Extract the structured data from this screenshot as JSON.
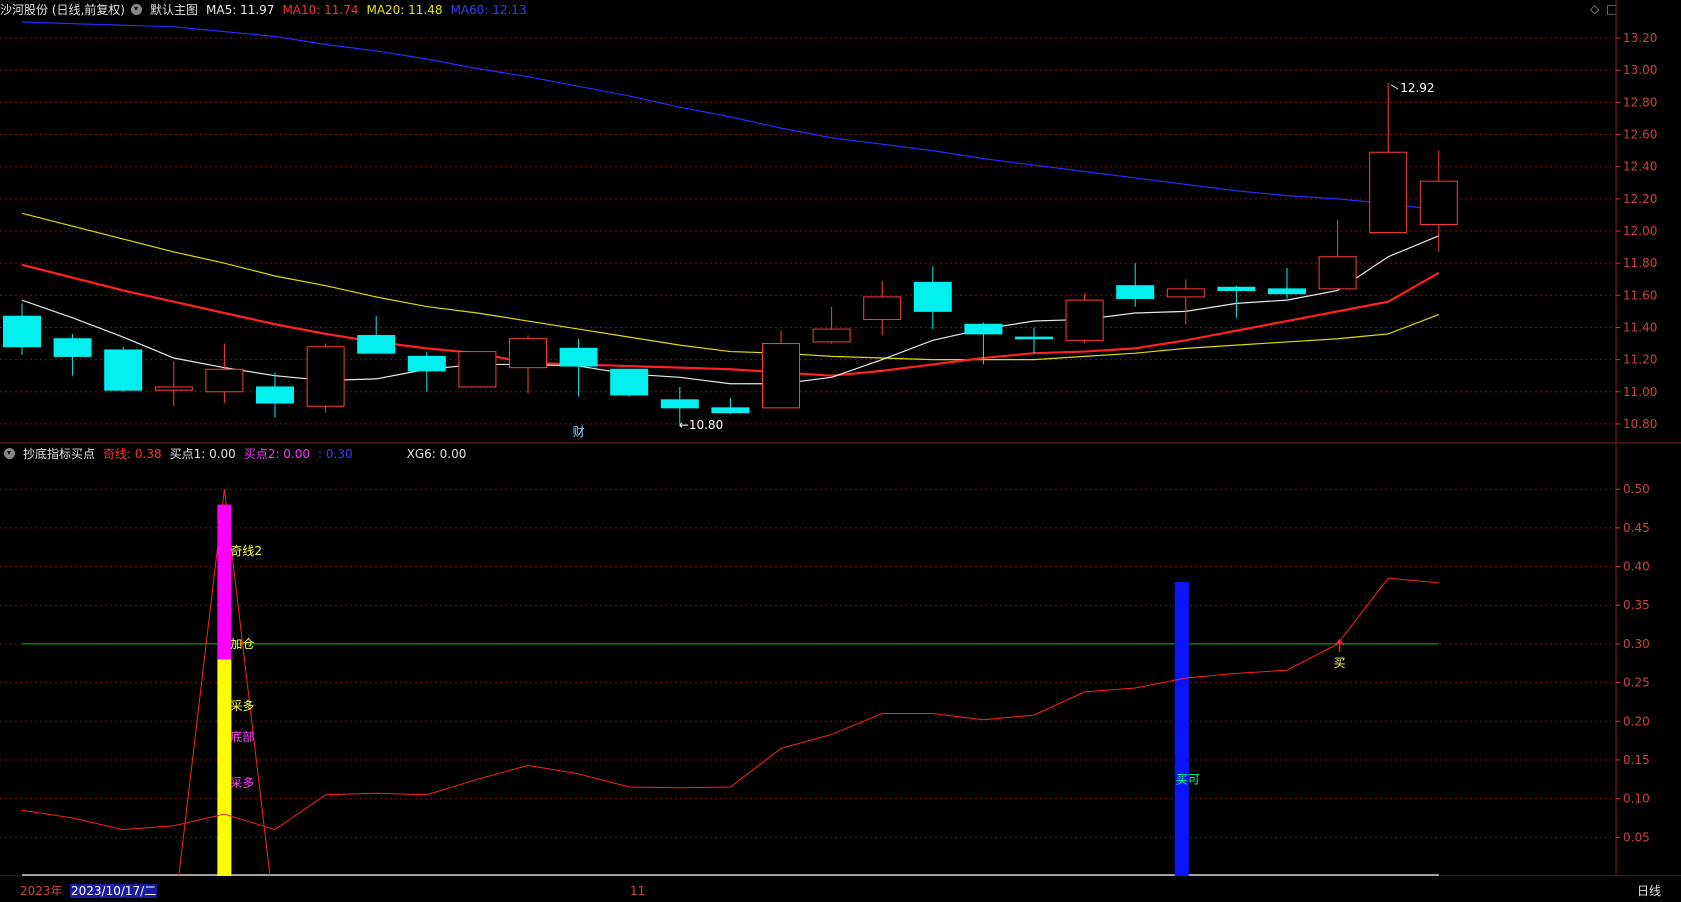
{
  "main_header": {
    "stock": "沙河股份 (日线,前复权)",
    "theme": "默认主图",
    "ma5": "MA5: 11.97",
    "ma10": "MA10: 11.74",
    "ma20": "MA20: 11.48",
    "ma60": "MA60: 12.13"
  },
  "indicator_header": {
    "name": "抄底指标买点",
    "qx": "奇线: 0.38",
    "buy1": "买点1: 0.00",
    "buy2": "买点2: 0.00",
    "blank": ": 0.30",
    "xg6": "XG6: 0.00"
  },
  "corner_controls": {
    "diamond": "◇",
    "square": "□"
  },
  "colors": {
    "bg": "#000000",
    "up": "#ff3c3c",
    "down": "#00f0f0",
    "ma5": "#e8e8e8",
    "ma10": "#ff2020",
    "ma20": "#dcdc00",
    "ma60": "#2a2aff",
    "grid": "#7a1010",
    "axis": "#d04040"
  },
  "price_axis": [
    "13.20",
    "13.00",
    "12.80",
    "12.60",
    "12.40",
    "12.20",
    "12.00",
    "11.80",
    "11.60",
    "11.40",
    "11.20",
    "11.00",
    "10.80"
  ],
  "indicator_axis": [
    "0.50",
    "0.45",
    "0.40",
    "0.35",
    "0.30",
    "0.25",
    "0.20",
    "0.15",
    "0.10",
    "0.05"
  ],
  "annotations": {
    "high": "12.92",
    "low": "←10.80",
    "cai": "财",
    "qx2": "奇线2",
    "jiacang": "加仓",
    "caiduo1": "采多",
    "dibu": "底部",
    "caiduo2": "采多",
    "maike": "买可",
    "mai": "买"
  },
  "time_bar": {
    "year": "2023年",
    "date": "2023/10/17/二",
    "month": "11",
    "period": "日线"
  },
  "chart_data": {
    "type": "candlestick",
    "candles": [
      {
        "o": 11.47,
        "h": 11.55,
        "l": 11.23,
        "c": 11.28
      },
      {
        "o": 11.33,
        "h": 11.36,
        "l": 11.1,
        "c": 11.22
      },
      {
        "o": 11.26,
        "h": 11.28,
        "l": 11.0,
        "c": 11.01
      },
      {
        "o": 11.01,
        "h": 11.19,
        "l": 10.91,
        "c": 11.03
      },
      {
        "o": 11.0,
        "h": 11.3,
        "l": 10.93,
        "c": 11.14
      },
      {
        "o": 11.03,
        "h": 11.12,
        "l": 10.84,
        "c": 10.93
      },
      {
        "o": 10.91,
        "h": 11.3,
        "l": 10.87,
        "c": 11.28
      },
      {
        "o": 11.35,
        "h": 11.47,
        "l": 11.24,
        "c": 11.24
      },
      {
        "o": 11.22,
        "h": 11.25,
        "l": 11.0,
        "c": 11.13
      },
      {
        "o": 11.03,
        "h": 11.25,
        "l": 11.03,
        "c": 11.25
      },
      {
        "o": 11.15,
        "h": 11.35,
        "l": 10.99,
        "c": 11.33
      },
      {
        "o": 11.27,
        "h": 11.33,
        "l": 10.97,
        "c": 11.16
      },
      {
        "o": 11.14,
        "h": 11.14,
        "l": 10.97,
        "c": 10.98
      },
      {
        "o": 10.95,
        "h": 11.03,
        "l": 10.8,
        "c": 10.9
      },
      {
        "o": 10.9,
        "h": 10.96,
        "l": 10.86,
        "c": 10.87
      },
      {
        "o": 10.9,
        "h": 11.38,
        "l": 10.9,
        "c": 11.3
      },
      {
        "o": 11.31,
        "h": 11.53,
        "l": 11.3,
        "c": 11.39
      },
      {
        "o": 11.45,
        "h": 11.69,
        "l": 11.35,
        "c": 11.59
      },
      {
        "o": 11.68,
        "h": 11.78,
        "l": 11.39,
        "c": 11.5
      },
      {
        "o": 11.42,
        "h": 11.43,
        "l": 11.17,
        "c": 11.36
      },
      {
        "o": 11.34,
        "h": 11.4,
        "l": 11.24,
        "c": 11.33
      },
      {
        "o": 11.32,
        "h": 11.61,
        "l": 11.3,
        "c": 11.57
      },
      {
        "o": 11.66,
        "h": 11.8,
        "l": 11.53,
        "c": 11.58
      },
      {
        "o": 11.59,
        "h": 11.7,
        "l": 11.42,
        "c": 11.64
      },
      {
        "o": 11.65,
        "h": 11.66,
        "l": 11.46,
        "c": 11.63
      },
      {
        "o": 11.64,
        "h": 11.77,
        "l": 11.58,
        "c": 11.61
      },
      {
        "o": 11.64,
        "h": 12.07,
        "l": 11.64,
        "c": 11.84
      },
      {
        "o": 11.99,
        "h": 12.92,
        "l": 11.99,
        "c": 12.49
      },
      {
        "o": 12.04,
        "h": 12.5,
        "l": 11.87,
        "c": 12.31
      }
    ],
    "ma5": [
      11.57,
      11.46,
      11.34,
      11.21,
      11.15,
      11.1,
      11.07,
      11.08,
      11.14,
      11.17,
      11.17,
      11.16,
      11.11,
      11.09,
      11.05,
      11.05,
      11.09,
      11.2,
      11.32,
      11.39,
      11.44,
      11.45,
      11.49,
      11.5,
      11.55,
      11.57,
      11.63,
      11.84,
      11.97
    ],
    "ma10": [
      11.79,
      11.71,
      11.63,
      11.56,
      11.49,
      11.42,
      11.36,
      11.31,
      11.27,
      11.24,
      11.18,
      11.17,
      11.16,
      11.15,
      11.14,
      11.12,
      11.1,
      11.13,
      11.17,
      11.21,
      11.24,
      11.25,
      11.27,
      11.32,
      11.38,
      11.44,
      11.5,
      11.56,
      11.74
    ],
    "ma20": [
      12.11,
      12.03,
      11.95,
      11.87,
      11.8,
      11.72,
      11.66,
      11.59,
      11.53,
      11.49,
      11.44,
      11.39,
      11.34,
      11.29,
      11.25,
      11.24,
      11.22,
      11.21,
      11.2,
      11.2,
      11.2,
      11.22,
      11.24,
      11.27,
      11.29,
      11.31,
      11.33,
      11.36,
      11.48
    ],
    "ma60": [
      13.3,
      13.29,
      13.28,
      13.27,
      13.24,
      13.21,
      13.16,
      13.12,
      13.07,
      13.01,
      12.96,
      12.9,
      12.84,
      12.77,
      12.71,
      12.64,
      12.58,
      12.54,
      12.5,
      12.45,
      12.41,
      12.37,
      12.33,
      12.29,
      12.25,
      12.22,
      12.2,
      12.17,
      12.13
    ],
    "indicator": {
      "line": [
        0.085,
        0.075,
        0.06,
        0.065,
        0.08,
        0.06,
        0.105,
        0.107,
        0.105,
        0.125,
        0.143,
        0.132,
        0.115,
        0.114,
        0.115,
        0.165,
        0.183,
        0.21,
        0.21,
        0.202,
        0.208,
        0.238,
        0.243,
        0.256,
        0.262,
        0.266,
        0.3,
        0.385,
        0.379
      ],
      "reference_line": 0.3,
      "spike": {
        "index": 4,
        "peak": 0.5,
        "magenta": [
          0.28,
          0.48
        ],
        "yellow": [
          0.0,
          0.28
        ]
      },
      "blue_bar": {
        "index": 23,
        "value": 0.38
      }
    },
    "price_range": [
      10.7,
      13.3
    ],
    "indicator_range": [
      0.0,
      0.53
    ]
  }
}
